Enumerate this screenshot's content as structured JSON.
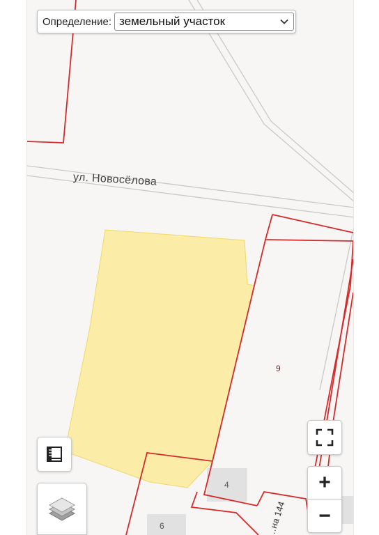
{
  "definition": {
    "label": "Определение:",
    "selected": "земельный участок"
  },
  "map": {
    "street_name": "ул. Новосёлова",
    "parcel_number": "9",
    "building_labels": [
      "4",
      "6"
    ],
    "road_label": "…на 144",
    "colors": {
      "background": "#f7f6f4",
      "parcel_border": "#d42a2a",
      "highlighted_parcel": "#fbeb9a",
      "building": "#e1e1e1",
      "road_outline": "#c9c9c9"
    }
  },
  "controls": {
    "zoom_in": "+",
    "zoom_out": "−",
    "fullscreen_icon": "fullscreen-icon",
    "ruler_icon": "ruler-icon",
    "layers_icon": "layers-icon"
  }
}
